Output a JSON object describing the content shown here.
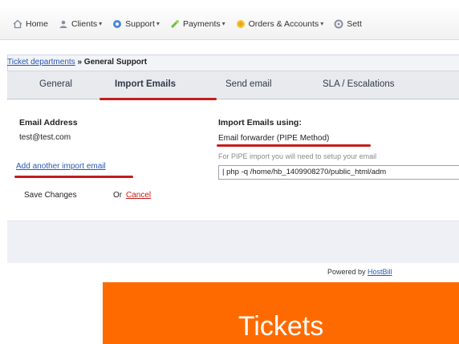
{
  "nav": {
    "items": [
      {
        "label": "Home",
        "icon": "home-icon",
        "has_dropdown": false
      },
      {
        "label": "Clients",
        "icon": "clients-icon",
        "has_dropdown": true
      },
      {
        "label": "Support",
        "icon": "support-icon",
        "has_dropdown": true
      },
      {
        "label": "Payments",
        "icon": "payments-icon",
        "has_dropdown": true
      },
      {
        "label": "Orders & Accounts",
        "icon": "orders-icon",
        "has_dropdown": true
      },
      {
        "label": "Sett",
        "icon": "settings-icon",
        "has_dropdown": false
      }
    ]
  },
  "breadcrumb": {
    "link": "Ticket departments",
    "separator": "»",
    "current": "General Support"
  },
  "tabs": [
    {
      "label": "General",
      "active": false
    },
    {
      "label": "Import Emails",
      "active": true
    },
    {
      "label": "Send email",
      "active": false
    },
    {
      "label": "SLA / Escalations",
      "active": false
    }
  ],
  "form": {
    "email_col_header": "Email Address",
    "import_col_header": "Import Emails using:",
    "email_value": "test@test.com",
    "import_method": "Email forwarder (PIPE Method)",
    "help_text": "For PIPE import you will need to setup your email",
    "command_value": "| php -q /home/hb_1409908270/public_html/adm",
    "add_link": "Add another import email",
    "save_label": "Save Changes",
    "or_label": "Or",
    "cancel_label": "Cancel"
  },
  "footer": {
    "powered_prefix": "Powered by",
    "brand": "HostBill"
  },
  "banner": {
    "label": "Tickets",
    "color": "#ff6a00"
  },
  "colors": {
    "accent_red": "#c51d1d",
    "link_blue": "#2a58b5"
  }
}
